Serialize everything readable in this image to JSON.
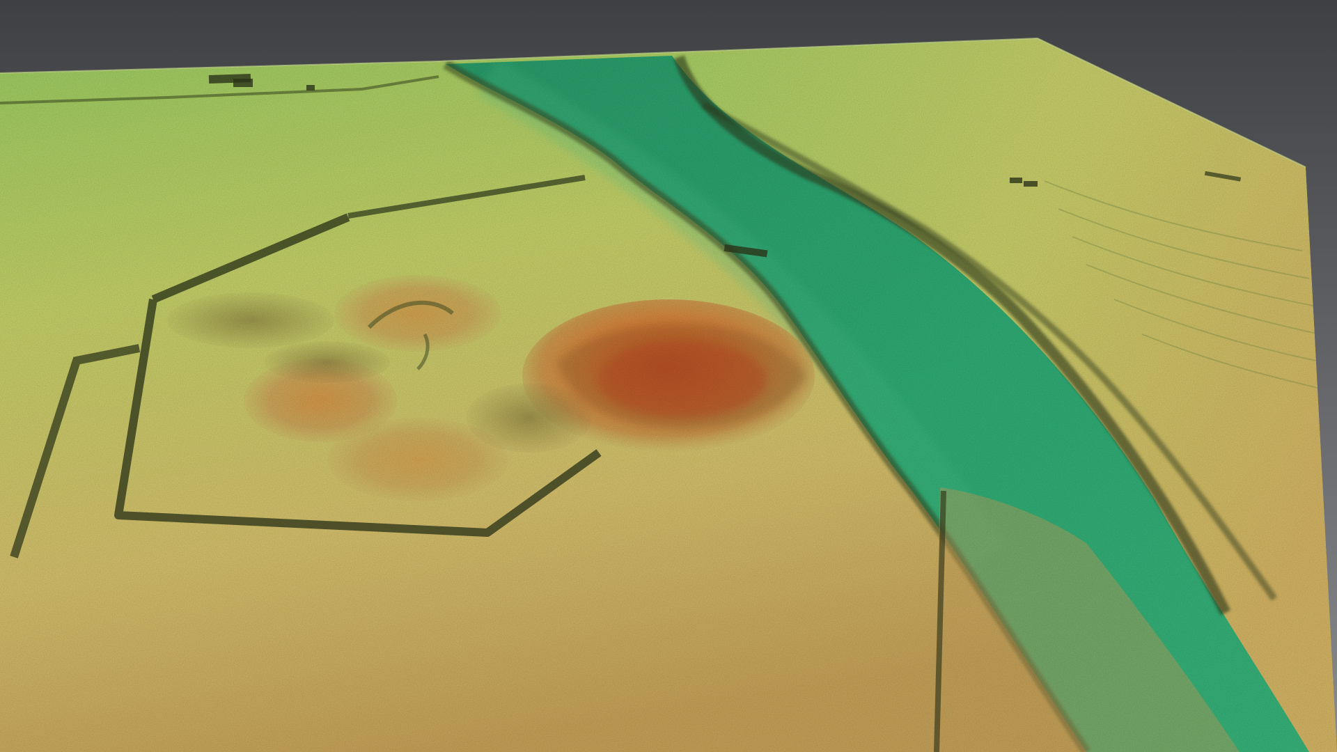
{
  "scene": {
    "type": "3d-lidar-terrain-render",
    "colors": {
      "background_top": "#3f4043",
      "background_bottom": "#8a8b8f",
      "river": "#2fae76",
      "river_light": "#4cc48c",
      "lowland_green": "#8cc65a",
      "yellow_green": "#c7d46a",
      "sand": "#d9c46e",
      "tan": "#c9a55a",
      "orange_high": "#e07a33",
      "red_peak": "#d9552a",
      "ridge_shadow": "#2f3a1c"
    },
    "labels": []
  }
}
